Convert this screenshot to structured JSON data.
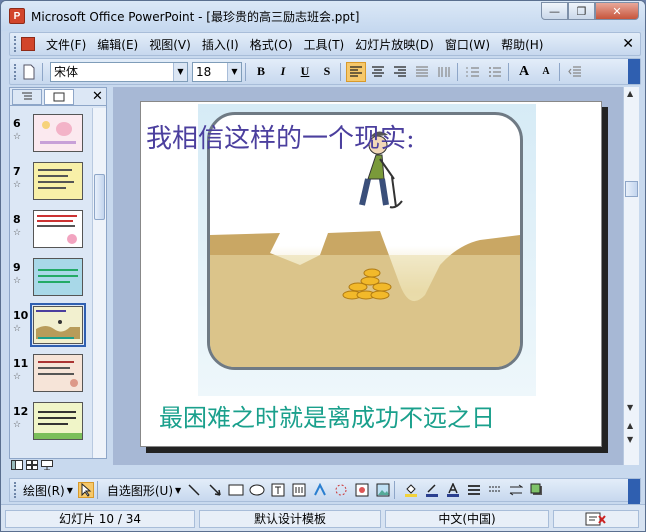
{
  "window": {
    "title": "Microsoft Office PowerPoint - [最珍贵的高三励志班会.ppt]",
    "app_icon_letter": "P",
    "minimize_glyph": "—",
    "restore_glyph": "❐",
    "close_glyph": "✕"
  },
  "menubar": {
    "items": [
      {
        "label": "文件(F)"
      },
      {
        "label": "编辑(E)"
      },
      {
        "label": "视图(V)"
      },
      {
        "label": "插入(I)"
      },
      {
        "label": "格式(O)"
      },
      {
        "label": "工具(T)"
      },
      {
        "label": "幻灯片放映(D)"
      },
      {
        "label": "窗口(W)"
      },
      {
        "label": "帮助(H)"
      }
    ],
    "close_glyph": "✕"
  },
  "toolbar": {
    "font_name": "宋体",
    "font_size": "18",
    "bold": "B",
    "italic": "I",
    "underline": "U",
    "shadow": "S",
    "font_grow": "A",
    "font_shrink": "A"
  },
  "left_pane": {
    "close_glyph": "✕",
    "thumbnails": [
      {
        "number": "6",
        "star": "☆",
        "bg": "#fbe9ef"
      },
      {
        "number": "7",
        "star": "☆",
        "bg": "#f8f0a8"
      },
      {
        "number": "8",
        "star": "☆",
        "bg": "#ffffff"
      },
      {
        "number": "9",
        "star": "☆",
        "bg": "#a8d8e8"
      },
      {
        "number": "10",
        "star": "☆",
        "bg": "#f2f0cf",
        "selected": true
      },
      {
        "number": "11",
        "star": "☆",
        "bg": "#f6e4d8"
      },
      {
        "number": "12",
        "star": "☆",
        "bg": "#f0f5c8"
      }
    ]
  },
  "slide": {
    "title": "我相信这样的一个现实:",
    "caption": "最困难之时就是离成功不远之日",
    "colors": {
      "title": "#4b3f9e",
      "caption": "#1aa08c"
    }
  },
  "drawbar": {
    "draw_label": "绘图(R)",
    "autoshape_label": "自选图形(U)"
  },
  "statusbar": {
    "slide_info": "幻灯片 10 / 34",
    "template": "默认设计模板",
    "language": "中文(中国)"
  }
}
